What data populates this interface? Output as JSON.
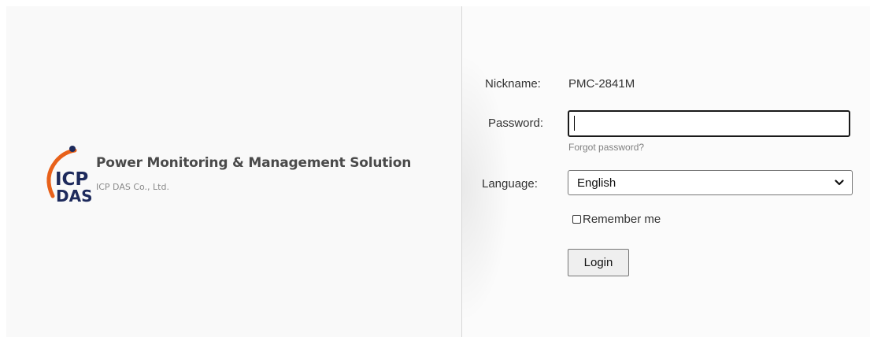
{
  "brand": {
    "logo_top": "ICP",
    "logo_bottom": "DAS",
    "title": "Power Monitoring & Management Solution",
    "subtitle": "ICP DAS Co., Ltd.",
    "logo_colors": {
      "orange": "#e8611a",
      "navy": "#1d2a5c"
    }
  },
  "form": {
    "nickname_label": "Nickname:",
    "nickname_value": "PMC-2841M",
    "password_label": "Password:",
    "password_value": "",
    "forgot_link": "Forgot password?",
    "language_label": "Language:",
    "language_selected": "English",
    "remember_label": "Remember me",
    "remember_checked": false,
    "login_button": "Login"
  }
}
